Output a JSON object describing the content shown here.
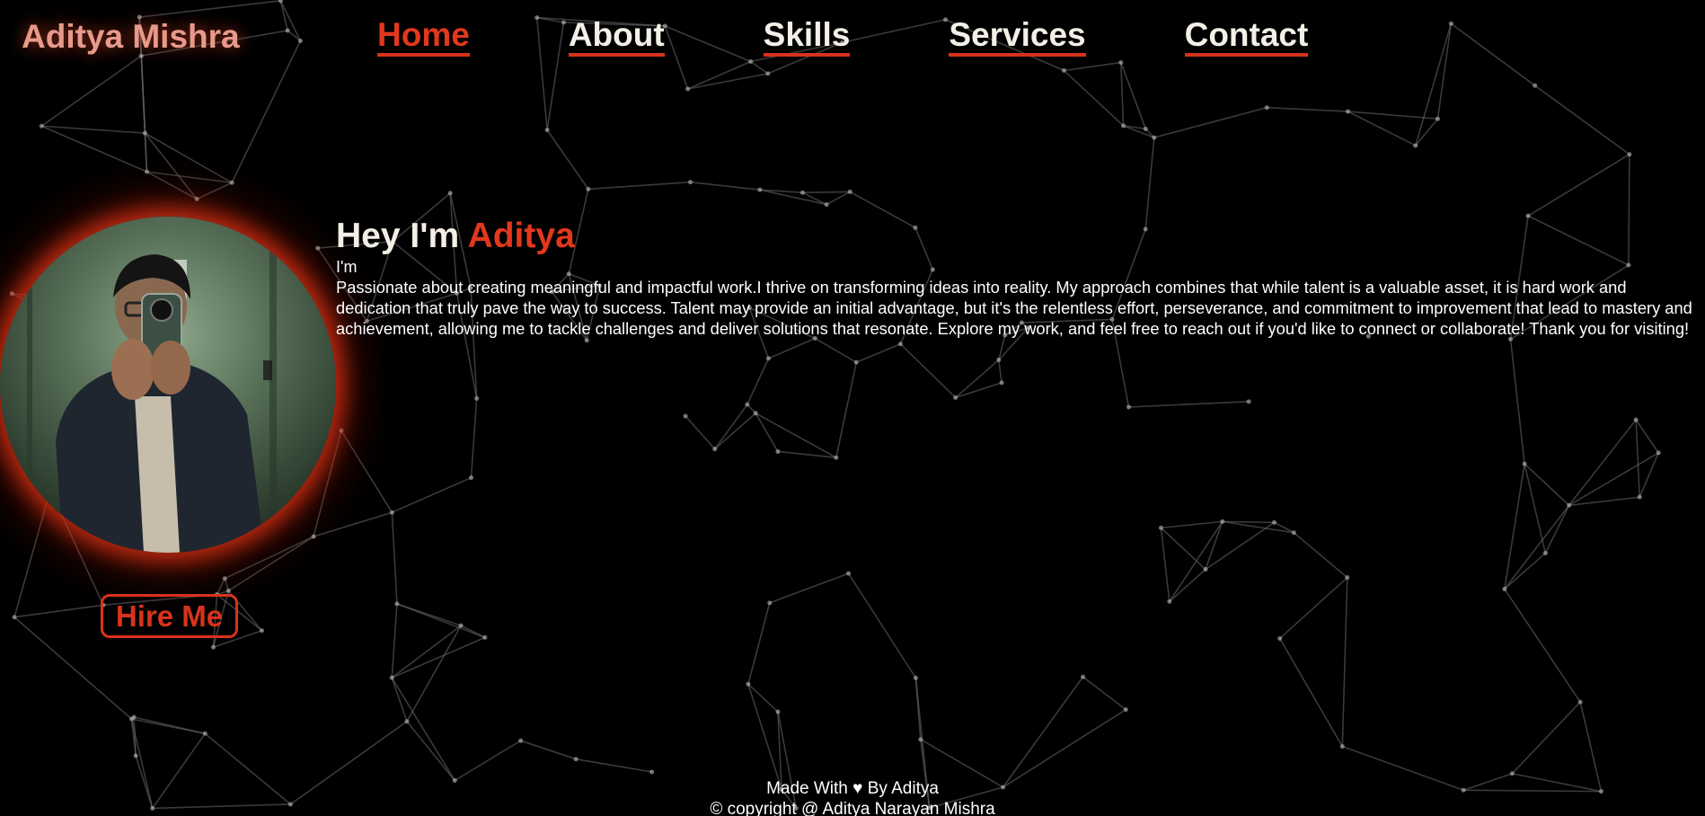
{
  "brand": "Aditya Mishra",
  "nav": {
    "items": [
      {
        "label": "Home",
        "active": true
      },
      {
        "label": "About",
        "active": false
      },
      {
        "label": "Skills",
        "active": false
      },
      {
        "label": "Services",
        "active": false
      },
      {
        "label": "Contact",
        "active": false
      }
    ]
  },
  "hero": {
    "greeting": "Hey I'm ",
    "name": "Aditya",
    "im_text": "I'm",
    "description": "Passionate about creating meaningful and impactful work.I thrive on transforming ideas into reality. My approach combines that while talent is a valuable asset, it is hard work and dedication that truly pave the way to success. Talent may provide an initial advantage, but it's the relentless effort, perseverance, and commitment to improvement that lead to mastery and achievement, allowing me to tackle challenges and deliver solutions that resonate. Explore my work, and feel free to reach out if you'd like to connect or collaborate! Thank you for visiting!",
    "hire_label": "Hire Me"
  },
  "footer": {
    "made_with": "Made With ♥ By Aditya",
    "copyright": "© copyright @ Aditya Narayan Mishra"
  },
  "colors": {
    "accent": "#e2381d",
    "brand": "#e79a8a",
    "background": "#000000",
    "text": "#f4efe6"
  },
  "icons": {
    "heart": "heart-icon"
  }
}
